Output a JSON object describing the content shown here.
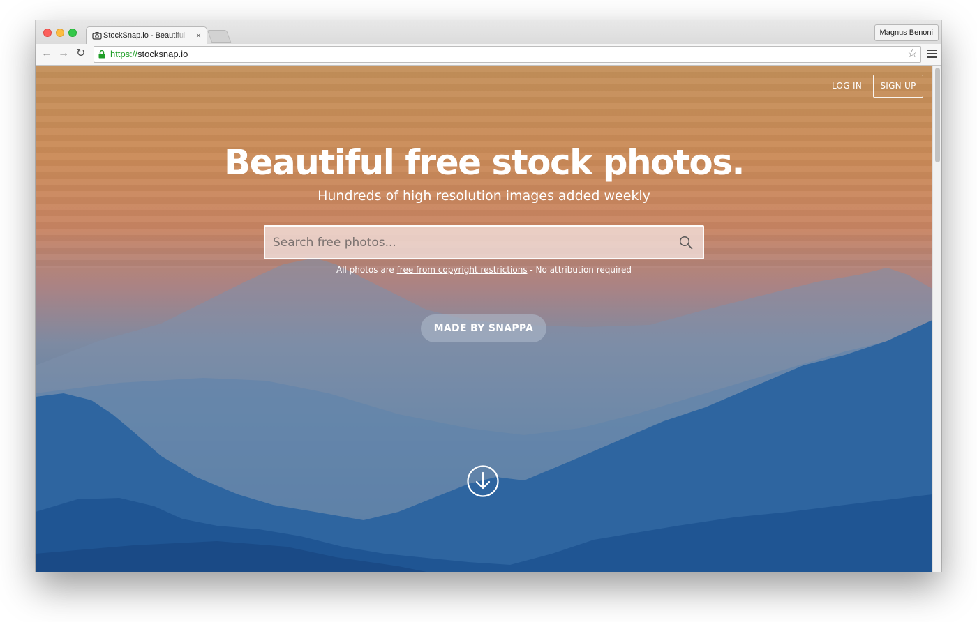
{
  "browser": {
    "tab": {
      "title": "StockSnap.io - Beautiful Free Stock Photos",
      "close_glyph": "×",
      "icon": "camera-icon"
    },
    "profile_name": "Magnus Benoni",
    "url_scheme": "https://",
    "url_host": "stocksnap.io",
    "icons": {
      "back": "←",
      "forward": "→",
      "reload": "↻",
      "star": "☆"
    },
    "colors": {
      "secure_scheme": "#1f9e28",
      "traffic_close": "#fc605c",
      "traffic_minimize": "#fdbc40",
      "traffic_maximize": "#34c84a"
    }
  },
  "header": {
    "login_label": "LOG IN",
    "signup_label": "SIGN UP"
  },
  "hero": {
    "headline": "Beautiful free stock photos.",
    "subheadline": "Hundreds of high resolution images added weekly",
    "search": {
      "placeholder": "Search free photos...",
      "value": ""
    },
    "notice": {
      "prefix": "All photos are ",
      "link": "free from copyright restrictions",
      "suffix": " - No attribution required"
    },
    "made_by_label": "MADE BY SNAPPA",
    "scroll_icon": "arrow-down-circle-icon"
  }
}
